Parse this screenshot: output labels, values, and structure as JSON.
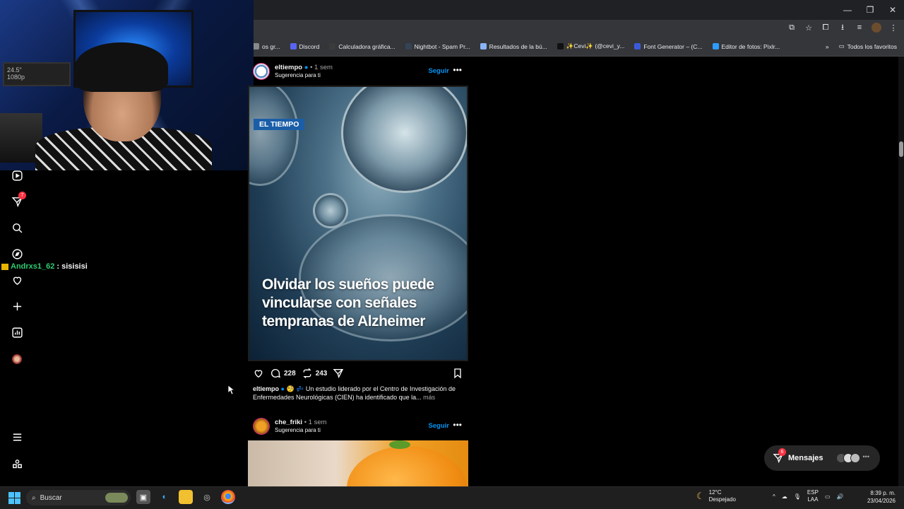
{
  "browser": {
    "window_controls": [
      "—",
      "❐",
      "✕"
    ],
    "bookmarks": [
      {
        "label": "os gr...",
        "color": "#888888"
      },
      {
        "label": "Discord",
        "color": "#5865f2"
      },
      {
        "label": "Calculadora gráfica...",
        "color": "#3b3b3b"
      },
      {
        "label": "Nightbot - Spam Pr...",
        "color": "#334455"
      },
      {
        "label": "Resultados de la bú...",
        "color": "#8ab4f8"
      },
      {
        "label": "✨Cevi✨ (@cevi_y...",
        "color": "#111111"
      },
      {
        "label": "Font Generator – (C...",
        "color": "#3a5bd9"
      },
      {
        "label": "Editor de fotos: Pixlr...",
        "color": "#2f9bff"
      }
    ],
    "bookmarks_more": "»",
    "all_favorites": "Todos los favoritos"
  },
  "stream": {
    "monitor_text": "24.5\"\n1080p",
    "chat_user": "Andrxs1_62",
    "chat_message": " : sisisisi"
  },
  "sidebar": {
    "notifications_badge": "7"
  },
  "post1": {
    "username": "eltiempo",
    "time": " • 1 sem",
    "subtitle": "Sugerencia para ti",
    "follow": "Seguir",
    "more": "•••",
    "badge": "EL TIEMPO",
    "headline": "Olvidar los sueños puede vincularse con señales tempranas de Alzheimer",
    "comments": "228",
    "reposts": "243",
    "caption_user": "eltiempo",
    "caption_text": " 🧐 💤 Un estudio liderado por el Centro de Investigación de Enfermedades Neurológicas (CIEN) ha identificado que la...",
    "caption_more": " más"
  },
  "post2": {
    "username": "che_friki",
    "time": " • 1 sem",
    "subtitle": "Sugerencia para ti",
    "follow": "Seguir",
    "more": "•••"
  },
  "messages": {
    "label": "Mensajes",
    "badge": "6"
  },
  "taskbar": {
    "search_placeholder": "Buscar",
    "weather_temp": "12°C",
    "weather_desc": "Despejado",
    "lang_top": "ESP",
    "lang_bottom": "LAA",
    "time": "8:39 p. m.",
    "date": "23/04/2026"
  },
  "colors": {
    "accent": "#0095f6",
    "badge": "#ff3040",
    "chat_user": "#2ecc71"
  }
}
